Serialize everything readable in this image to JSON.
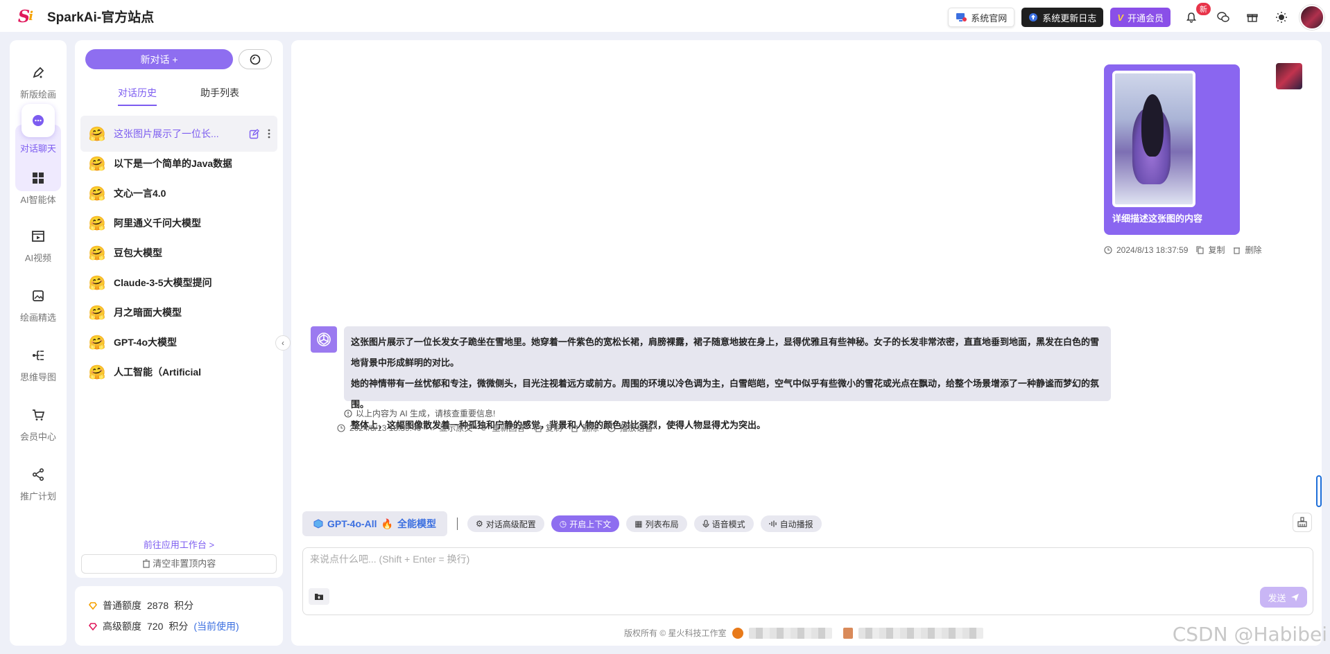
{
  "header": {
    "logo_text": "S",
    "logo_accent": "i",
    "title": "SparkAi-官方站点",
    "buttons": {
      "official_site": "系统官网",
      "changelog": "系统更新日志",
      "vip": "开通会员"
    },
    "notification_badge": "新"
  },
  "rail": {
    "items": [
      {
        "label": "新版绘画",
        "icon": "pen-icon"
      },
      {
        "label": "对话聊天",
        "icon": "chat-icon"
      },
      {
        "label": "AI智能体",
        "icon": "grid-icon"
      },
      {
        "label": "AI视频",
        "icon": "video-icon"
      },
      {
        "label": "绘画精选",
        "icon": "image-icon"
      },
      {
        "label": "思维导图",
        "icon": "mindmap-icon"
      },
      {
        "label": "会员中心",
        "icon": "cart-icon"
      },
      {
        "label": "推广计划",
        "icon": "share-icon"
      }
    ]
  },
  "conversations": {
    "new_chat_label": "新对话 +",
    "tabs": [
      "对话历史",
      "助手列表"
    ],
    "items": [
      "这张图片展示了一位长...",
      "以下是一个简单的Java数据库",
      "文心一言4.0",
      "阿里通义千问大模型",
      "豆包大模型",
      "Claude-3-5大模型提问",
      "月之暗面大模型",
      "GPT-4o大模型",
      "人工智能（Artificial"
    ],
    "goto_workspace": "前往应用工作台 >",
    "clear_label": "清空非置顶内容"
  },
  "quota": {
    "normal_label": "普通额度",
    "normal_value": "2878",
    "normal_unit": "积分",
    "advanced_label": "高级额度",
    "advanced_value": "720",
    "advanced_unit": "积分",
    "current_tag": "(当前使用)"
  },
  "chat": {
    "user_message": "详细描述这张图的内容",
    "user_time": "2024/8/13 18:37:59",
    "user_copy": "复制",
    "user_delete": "删除",
    "bot_paragraphs": [
      "这张图片展示了一位长发女子跪坐在雪地里。她穿着一件紫色的宽松长裙，肩膀裸露，裙子随意地披在身上，显得优雅且有些神秘。女子的长发非常浓密，直直地垂到地面，黑发在白色的雪地背景中形成鲜明的对比。",
      "她的神情带有一丝忧郁和专注，微微侧头，目光注视着远方或前方。周围的环境以冷色调为主，白雪皑皑，空气中似乎有些微小的雪花或光点在飘动，给整个场景增添了一种静谧而梦幻的氛围。",
      "整体上，这幅图像散发着一种孤独和宁静的感觉，背景和人物的颜色对比强烈，使得人物显得尤为突出。"
    ],
    "disclaimer": "以上内容为 AI 生成，请核查重要信息!",
    "bot_time": "2024/8/13 18:39:40",
    "bot_actions": [
      "显示原文",
      "重新回答",
      "复制",
      "删除",
      "播放语音"
    ]
  },
  "composer": {
    "model_name": "GPT-4o-All",
    "model_tag": "全能模型",
    "tools": [
      "对话高级配置",
      "开启上下文",
      "列表布局",
      "语音模式",
      "自动播报"
    ],
    "placeholder": "来说点什么吧... (Shift + Enter = 换行)",
    "send_label": "发送"
  },
  "footer": {
    "copyright": "版权所有 © 星火科技工作室"
  },
  "watermark": "CSDN @Habibei",
  "colors": {
    "accent": "#7c5cf0",
    "vip": "#8a4fe8",
    "badge": "#e8344a"
  }
}
